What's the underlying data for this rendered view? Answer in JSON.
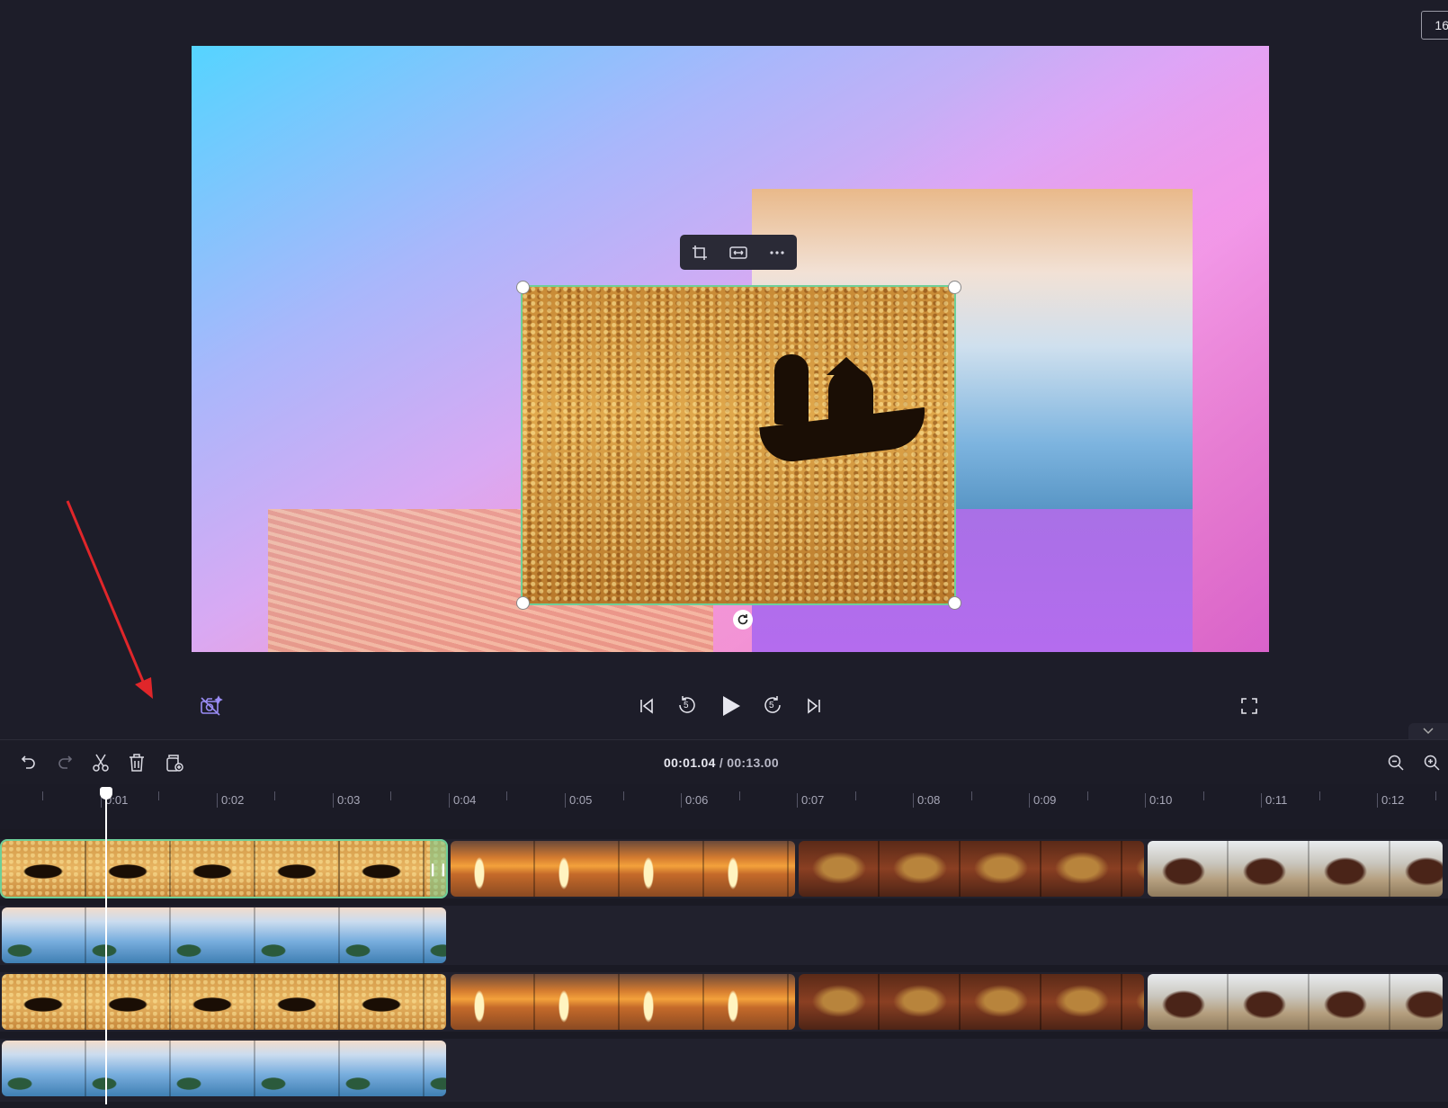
{
  "preview": {
    "aspect_ratio_label": "16",
    "playback": {
      "skip_back_seconds": "5",
      "skip_forward_seconds": "5"
    }
  },
  "timeline": {
    "current_time": "00:01.04",
    "separator": " / ",
    "total_time": "00:13.00",
    "ruler_labels": [
      "0:01",
      "0:02",
      "0:03",
      "0:04",
      "0:05",
      "0:06",
      "0:07",
      "0:08",
      "0:09",
      "0:10",
      "0:11",
      "0:12"
    ],
    "playhead_time_seconds": 1.04
  },
  "icons": {
    "crop": "crop-icon",
    "fit": "fit-icon",
    "more": "more-icon",
    "rotate": "rotate-icon",
    "auto_enhance": "ai-camera-icon",
    "fullscreen": "fullscreen-icon",
    "undo": "undo-icon",
    "redo": "redo-icon",
    "split": "scissors-icon",
    "delete": "trash-icon",
    "duplicate": "duplicate-icon",
    "zoom_out": "zoom-out-icon",
    "zoom_in": "zoom-in-icon"
  },
  "colors": {
    "selection_outline": "#6ecf98",
    "annotation_arrow": "#e0262a",
    "background": "#1d1d28"
  }
}
